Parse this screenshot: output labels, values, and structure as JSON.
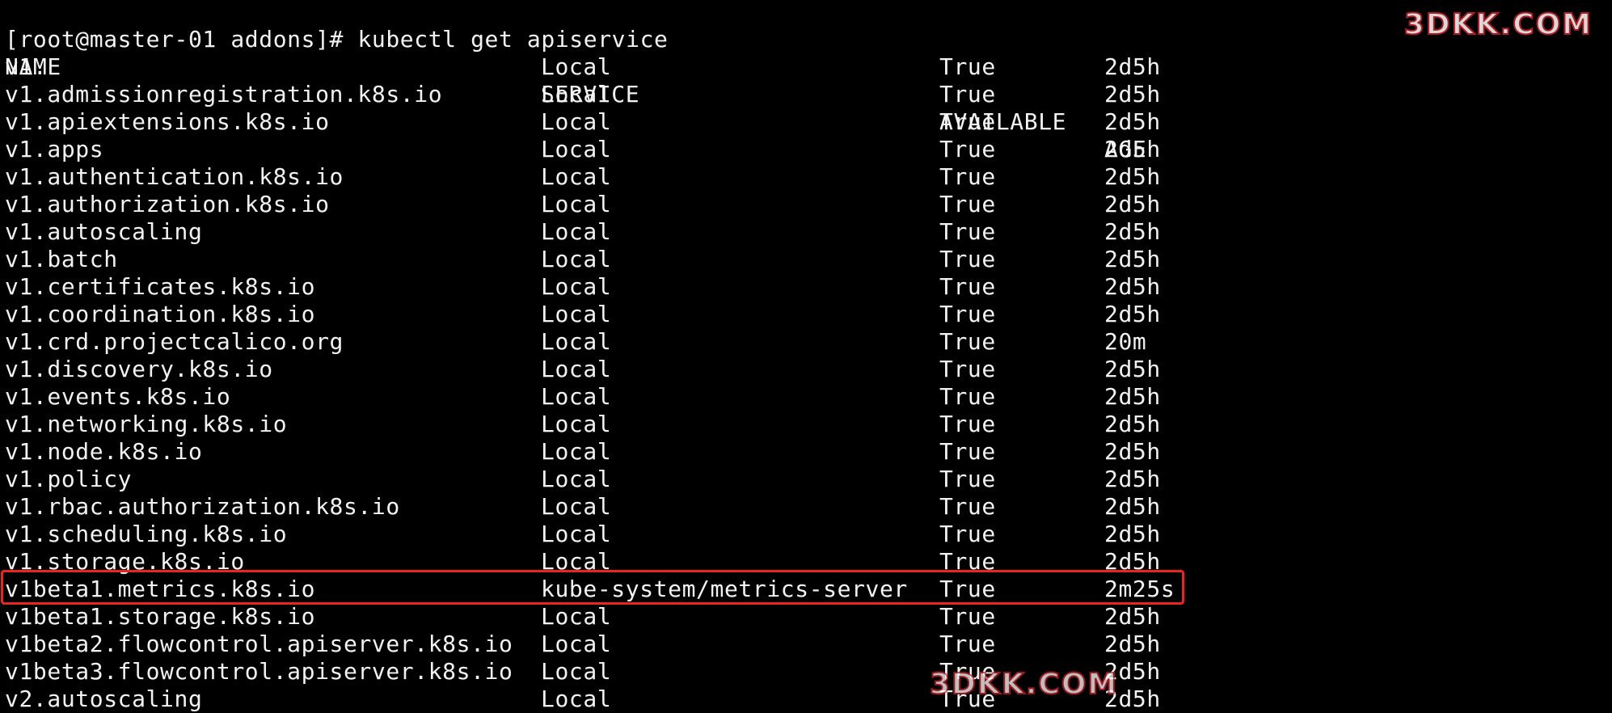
{
  "terminal": {
    "background": "#000000",
    "foreground": "#f2f2f2",
    "prompt": "[root@master-01 addons]# ",
    "command": "kubectl get apiservice",
    "highlight_color": "#e8261f"
  },
  "table": {
    "headers": {
      "name": "NAME",
      "service": "SERVICE",
      "available": "AVAILABLE",
      "age": "AGE"
    },
    "rows": [
      {
        "name": "v1.",
        "service": "Local",
        "available": "True",
        "age": "2d5h"
      },
      {
        "name": "v1.admissionregistration.k8s.io",
        "service": "Local",
        "available": "True",
        "age": "2d5h"
      },
      {
        "name": "v1.apiextensions.k8s.io",
        "service": "Local",
        "available": "True",
        "age": "2d5h"
      },
      {
        "name": "v1.apps",
        "service": "Local",
        "available": "True",
        "age": "2d5h"
      },
      {
        "name": "v1.authentication.k8s.io",
        "service": "Local",
        "available": "True",
        "age": "2d5h"
      },
      {
        "name": "v1.authorization.k8s.io",
        "service": "Local",
        "available": "True",
        "age": "2d5h"
      },
      {
        "name": "v1.autoscaling",
        "service": "Local",
        "available": "True",
        "age": "2d5h"
      },
      {
        "name": "v1.batch",
        "service": "Local",
        "available": "True",
        "age": "2d5h"
      },
      {
        "name": "v1.certificates.k8s.io",
        "service": "Local",
        "available": "True",
        "age": "2d5h"
      },
      {
        "name": "v1.coordination.k8s.io",
        "service": "Local",
        "available": "True",
        "age": "2d5h"
      },
      {
        "name": "v1.crd.projectcalico.org",
        "service": "Local",
        "available": "True",
        "age": "20m"
      },
      {
        "name": "v1.discovery.k8s.io",
        "service": "Local",
        "available": "True",
        "age": "2d5h"
      },
      {
        "name": "v1.events.k8s.io",
        "service": "Local",
        "available": "True",
        "age": "2d5h"
      },
      {
        "name": "v1.networking.k8s.io",
        "service": "Local",
        "available": "True",
        "age": "2d5h"
      },
      {
        "name": "v1.node.k8s.io",
        "service": "Local",
        "available": "True",
        "age": "2d5h"
      },
      {
        "name": "v1.policy",
        "service": "Local",
        "available": "True",
        "age": "2d5h"
      },
      {
        "name": "v1.rbac.authorization.k8s.io",
        "service": "Local",
        "available": "True",
        "age": "2d5h"
      },
      {
        "name": "v1.scheduling.k8s.io",
        "service": "Local",
        "available": "True",
        "age": "2d5h"
      },
      {
        "name": "v1.storage.k8s.io",
        "service": "Local",
        "available": "True",
        "age": "2d5h"
      },
      {
        "name": "v1beta1.metrics.k8s.io",
        "service": "kube-system/metrics-server",
        "available": "True",
        "age": "2m25s"
      },
      {
        "name": "v1beta1.storage.k8s.io",
        "service": "Local",
        "available": "True",
        "age": "2d5h"
      },
      {
        "name": "v1beta2.flowcontrol.apiserver.k8s.io",
        "service": "Local",
        "available": "True",
        "age": "2d5h"
      },
      {
        "name": "v1beta3.flowcontrol.apiserver.k8s.io",
        "service": "Local",
        "available": "True",
        "age": "2d5h"
      },
      {
        "name": "v2.autoscaling",
        "service": "Local",
        "available": "True",
        "age": "2d5h"
      }
    ]
  },
  "watermarks": {
    "top_right": "3DKK.COM",
    "bottom": "3DKK.COM"
  }
}
